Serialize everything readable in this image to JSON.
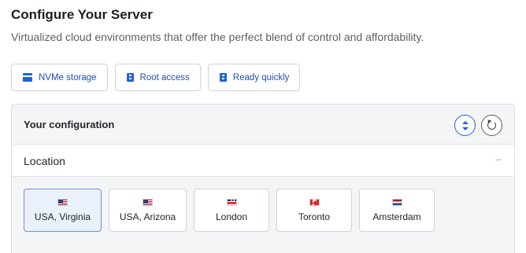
{
  "header": {
    "title": "Configure Your Server",
    "subtitle": "Virtualized cloud environments that offer the perfect blend of control and affordability."
  },
  "features": [
    {
      "label": "NVMe storage",
      "icon": "drive-icon"
    },
    {
      "label": "Root access",
      "icon": "server-icon"
    },
    {
      "label": "Ready quickly",
      "icon": "server-icon"
    }
  ],
  "config": {
    "title": "Your configuration",
    "location": {
      "title": "Location",
      "collapse_symbol": "–",
      "selected": "USA, Virginia",
      "options": [
        {
          "label": "USA, Virginia",
          "flag": "us-flag-icon"
        },
        {
          "label": "USA, Arizona",
          "flag": "us-flag-icon"
        },
        {
          "label": "London",
          "flag": "uk-flag-icon"
        },
        {
          "label": "Toronto",
          "flag": "canada-flag-icon"
        },
        {
          "label": "Amsterdam",
          "flag": "netherlands-flag-icon"
        }
      ]
    }
  },
  "colors": {
    "accent": "#1f63d8",
    "selected_bg": "#eaf1fb",
    "panel_bg": "#f4f5f6"
  }
}
